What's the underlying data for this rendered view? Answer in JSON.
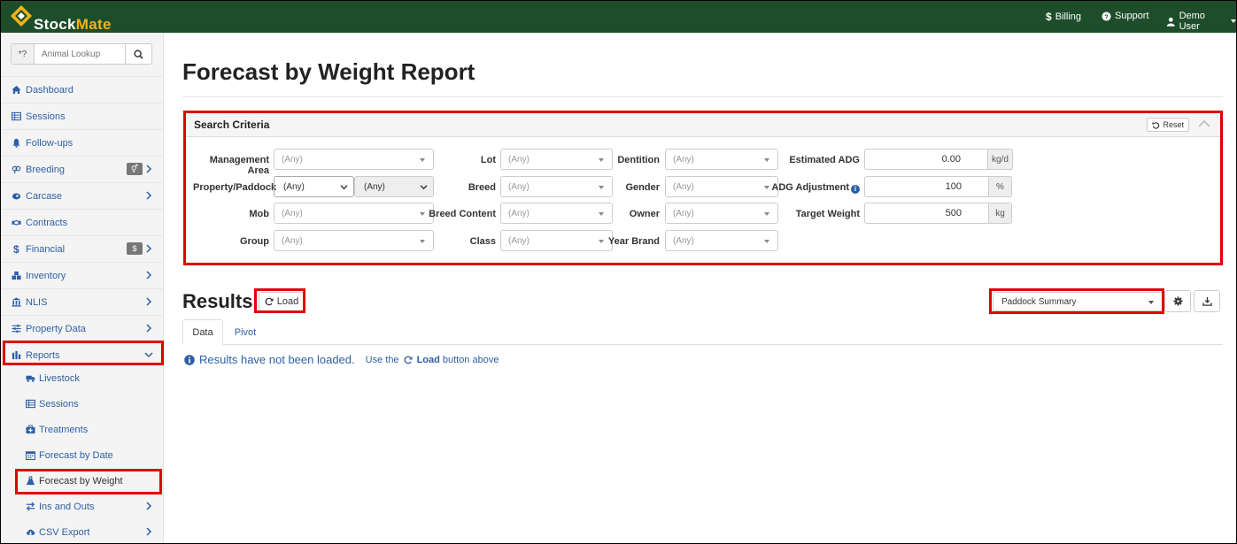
{
  "app": {
    "brand_a": "Stock",
    "brand_b": "Mate"
  },
  "topnav": {
    "billing": "Billing",
    "support": "Support",
    "user": "Demo User"
  },
  "lookup": {
    "prefix": "*?",
    "placeholder": "Animal Lookup"
  },
  "sidebar": {
    "items": [
      {
        "label": "Dashboard",
        "icon": "home-icon"
      },
      {
        "label": "Sessions",
        "icon": "table-icon"
      },
      {
        "label": "Follow-ups",
        "icon": "bell-icon"
      },
      {
        "label": "Breeding",
        "icon": "gender-icon",
        "badge": "⚥"
      },
      {
        "label": "Carcase",
        "icon": "steak-icon"
      },
      {
        "label": "Contracts",
        "icon": "handshake-icon"
      },
      {
        "label": "Financial",
        "icon": "dollar-icon",
        "badge": "$"
      },
      {
        "label": "Inventory",
        "icon": "boxes-icon"
      },
      {
        "label": "NLIS",
        "icon": "institution-icon"
      },
      {
        "label": "Property Data",
        "icon": "sliders-icon"
      },
      {
        "label": "Reports",
        "icon": "bar-chart-icon"
      }
    ],
    "reports_sub": [
      {
        "label": "Livestock",
        "icon": "truck-icon"
      },
      {
        "label": "Sessions",
        "icon": "table-icon"
      },
      {
        "label": "Treatments",
        "icon": "medkit-icon"
      },
      {
        "label": "Forecast by Date",
        "icon": "calendar-icon"
      },
      {
        "label": "Forecast by Weight",
        "icon": "weight-icon"
      },
      {
        "label": "Ins and Outs",
        "icon": "exchange-icon"
      },
      {
        "label": "CSV Export",
        "icon": "cloud-download-icon"
      }
    ]
  },
  "page": {
    "title": "Forecast by Weight Report"
  },
  "criteria": {
    "title": "Search Criteria",
    "reset": "Reset",
    "any": "(Any)",
    "labels": {
      "management_area": "Management Area",
      "property_paddock": "Property/Paddock",
      "mob": "Mob",
      "group": "Group",
      "lot": "Lot",
      "breed": "Breed",
      "breed_content": "Breed Content",
      "class": "Class",
      "dentition": "Dentition",
      "gender": "Gender",
      "owner": "Owner",
      "year_brand": "Year Brand",
      "estimated_adg": "Estimated ADG",
      "adg_adjustment": "ADG Adjustment",
      "target_weight": "Target Weight"
    },
    "values": {
      "estimated_adg": "0.00",
      "estimated_adg_unit": "kg/d",
      "adg_adjustment": "100",
      "adg_adjustment_unit": "%",
      "target_weight": "500",
      "target_weight_unit": "kg"
    }
  },
  "results": {
    "title": "Results",
    "load": "Load",
    "view": "Paddock Summary",
    "tabs": [
      "Data",
      "Pivot"
    ],
    "notice_main": "Results have not been loaded.",
    "notice_pre": "Use the",
    "notice_btn": "Load",
    "notice_post": "button above"
  },
  "colors": {
    "header_bg": "#1e4d2b",
    "brand_accent": "#f2b418",
    "link": "#2e5fa6",
    "highlight": "#e00000"
  }
}
